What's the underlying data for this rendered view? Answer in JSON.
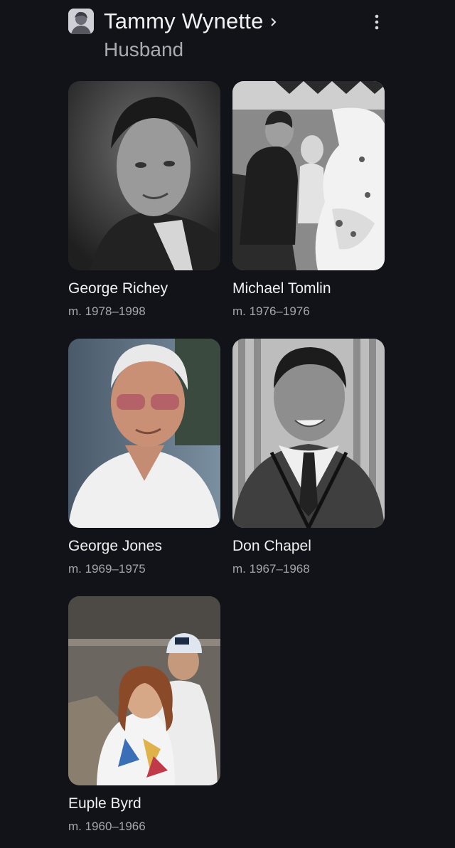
{
  "header": {
    "avatar_icon": "person-thumbnail-icon",
    "title": "Tammy Wynette",
    "subtitle": "Husband",
    "more_icon": "more-vert-icon"
  },
  "husbands": [
    {
      "name": "George Richey",
      "years": "m. 1978–1998"
    },
    {
      "name": "Michael Tomlin",
      "years": "m. 1976–1976"
    },
    {
      "name": "George Jones",
      "years": "m. 1969–1975"
    },
    {
      "name": "Don Chapel",
      "years": "m. 1967–1968"
    },
    {
      "name": "Euple Byrd",
      "years": "m. 1960–1966"
    }
  ],
  "colors": {
    "background": "#121318",
    "title": "#f1f1f3",
    "subtitle": "#a9abb2",
    "secondary_text": "#a4a6ad"
  }
}
